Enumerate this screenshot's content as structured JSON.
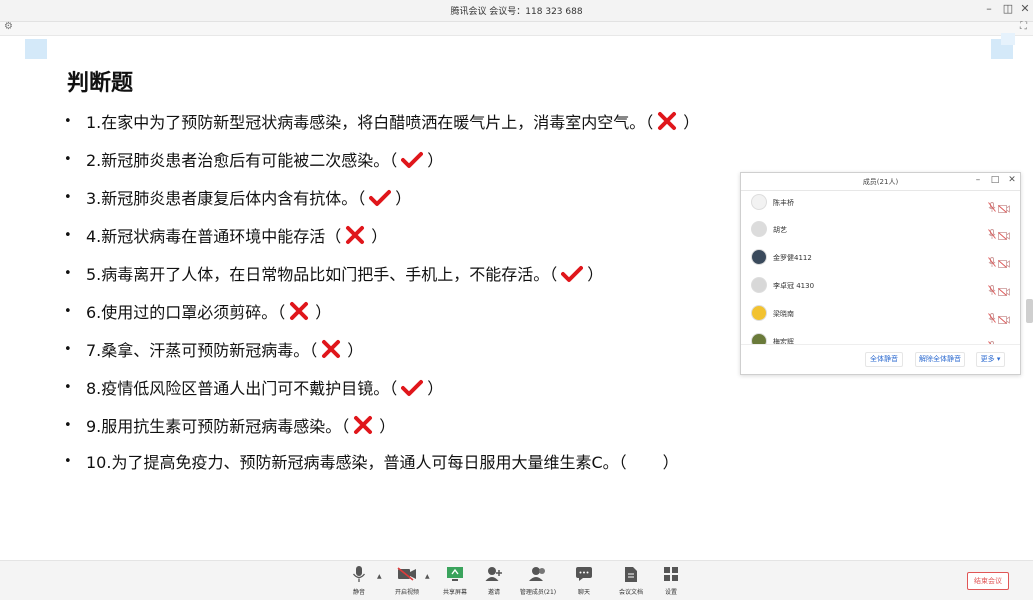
{
  "window": {
    "title": "腾讯会议  会议号：118 323 688",
    "minimize": "–",
    "restore": "◫",
    "close": "✕"
  },
  "slide": {
    "heading": "判断题",
    "bullet": "•",
    "questions": [
      {
        "text": "1.在家中为了预防新型冠状病毒感染，将白醋喷洒在暖气片上，消毒室内空气。（",
        "close": "）",
        "mark": "cross"
      },
      {
        "text": "2.新冠肺炎患者治愈后有可能被二次感染。（",
        "close": "）",
        "mark": "check"
      },
      {
        "text": "3.新冠肺炎患者康复后体内含有抗体。（",
        "close": "）",
        "mark": "check"
      },
      {
        "text": "4.新冠状病毒在普通环境中能存活（",
        "close": "）",
        "mark": "cross"
      },
      {
        "text": "5.病毒离开了人体，在日常物品比如门把手、手机上，不能存活。（",
        "close": "）",
        "mark": "check"
      },
      {
        "text": "6.使用过的口罩必须剪碎。（",
        "close": "）",
        "mark": "cross"
      },
      {
        "text": "7.桑拿、汗蒸可预防新冠病毒。（",
        "close": "）",
        "mark": "cross"
      },
      {
        "text": "8.疫情低风险区普通人出门可不戴护目镜。（",
        "close": "）",
        "mark": "check"
      },
      {
        "text": "9.服用抗生素可预防新冠病毒感染。（",
        "close": "）",
        "mark": "cross"
      },
      {
        "text": "10.为了提高免疫力、预防新冠病毒感染，普通人可每日服用大量维生素C。（",
        "close": "）",
        "mark": "none"
      }
    ],
    "colors": {
      "mark": "#e0161b",
      "decor": "#d4e9f9"
    }
  },
  "members_panel": {
    "title": "成员(21人)",
    "members": [
      {
        "name": "陈丰桥",
        "avatar_color": "#f2f2f2"
      },
      {
        "name": "胡艺",
        "avatar_color": "#dcdcdc"
      },
      {
        "name": "金罗健4112",
        "avatar_color": "#3a4a5c"
      },
      {
        "name": "李卓冠 4130",
        "avatar_color": "#d8d8d8"
      },
      {
        "name": "梁晓南",
        "avatar_color": "#f2c230"
      },
      {
        "name": "梅宏辉",
        "avatar_color": "#6a7a3a"
      }
    ],
    "buttons": {
      "mute_all": "全体静音",
      "unmute_all": "解除全体静音",
      "more": "更多 ▾"
    }
  },
  "toolbar": {
    "items": [
      {
        "label": "静音",
        "icon": "mic-icon"
      },
      {
        "label": "开启视频",
        "icon": "video-off-icon"
      },
      {
        "label": "共享屏幕",
        "icon": "share-screen-icon"
      },
      {
        "label": "邀请",
        "icon": "invite-icon"
      },
      {
        "label": "管理成员(21)",
        "icon": "members-icon"
      },
      {
        "label": "聊天",
        "icon": "chat-icon"
      },
      {
        "label": "会议文档",
        "icon": "document-icon"
      },
      {
        "label": "设置",
        "icon": "settings-icon"
      }
    ],
    "end_meeting": "结束会议",
    "caret": "▲"
  }
}
